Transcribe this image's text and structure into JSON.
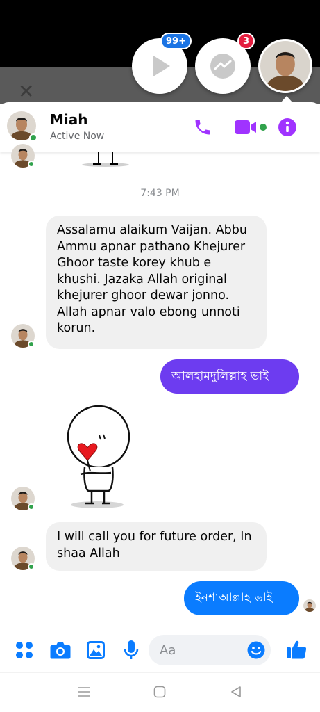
{
  "chat_heads": {
    "play_badge": "99+",
    "messenger_badge": "3"
  },
  "header": {
    "name": "Miah",
    "status": "Active Now"
  },
  "conversation": {
    "timestamp": "7:43 PM",
    "messages": [
      {
        "direction": "incoming",
        "text": "Assalamu alaikum Vaijan. Abbu Ammu apnar pathano Khejurer Ghoor taste korey khub e khushi. Jazaka Allah original khejurer ghoor dewar jonno. Allah apnar valo ebong unnoti korun."
      },
      {
        "direction": "outgoing",
        "text": "আলহামদুলিল্লাহ ভাই"
      },
      {
        "direction": "incoming",
        "type": "sticker"
      },
      {
        "direction": "incoming",
        "text": "I will call you for future order, In shaa Allah"
      },
      {
        "direction": "outgoing",
        "text": "ইনশাআল্লাহ ভাই"
      }
    ]
  },
  "composer": {
    "placeholder": "Aa"
  },
  "colors": {
    "accent_purple": "#a033ff",
    "outgoing_purple": "#6d3cf0",
    "outgoing_blue": "#0a7cff",
    "composer_blue": "#0a7cff",
    "online_green": "#31a24c",
    "badge_red": "#e41e3f",
    "badge_blue": "#1b74e4"
  },
  "icons": [
    "play-icon",
    "messenger-icon",
    "close-icon",
    "phone-icon",
    "video-icon",
    "info-icon",
    "apps-icon",
    "camera-icon",
    "gallery-icon",
    "microphone-icon",
    "emoji-icon",
    "thumbs-up-icon",
    "menu-nav-icon",
    "home-nav-icon",
    "back-nav-icon"
  ]
}
